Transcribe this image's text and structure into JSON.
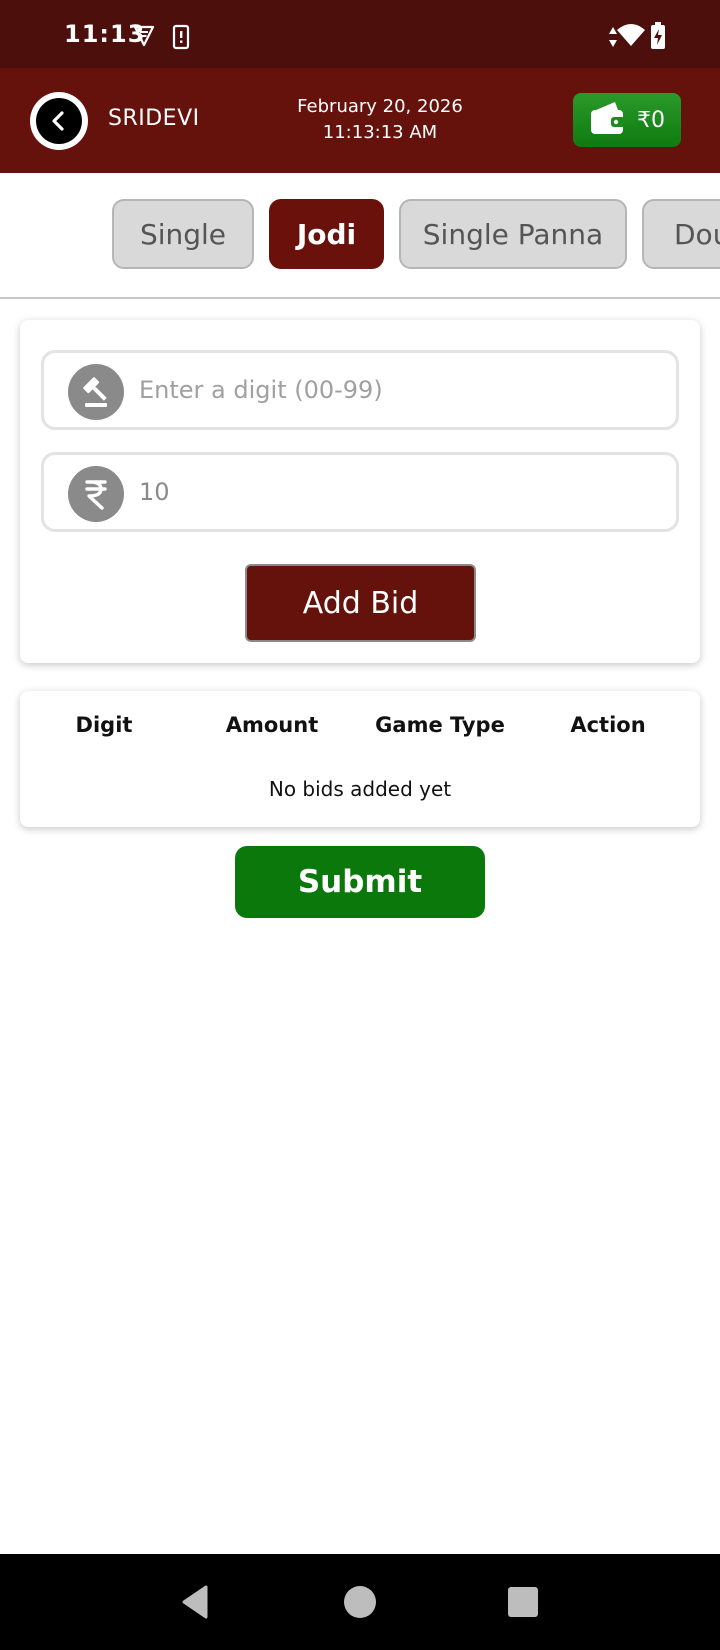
{
  "status_bar": {
    "time": "11:13",
    "icons": [
      "vpn-shield-icon",
      "sim-alert-icon",
      "data-arrows-icon",
      "wifi-icon",
      "battery-charging-icon"
    ]
  },
  "header": {
    "brand": "SRIDEVI",
    "date": "February 20, 2026",
    "time": "11:13:13 AM",
    "wallet_amount": "₹0",
    "back_icon": "chevron-left-icon",
    "wallet_icon": "wallet-icon"
  },
  "tabs": [
    {
      "label": "Single",
      "active": false
    },
    {
      "label": "Jodi",
      "active": true
    },
    {
      "label": "Single Panna",
      "active": false
    },
    {
      "label": "Double Panna",
      "active": false
    }
  ],
  "form": {
    "digit_placeholder": "Enter a digit (00-99)",
    "digit_icon": "gavel-icon",
    "amount_value": "10",
    "amount_icon": "rupee-icon",
    "add_bid_label": "Add Bid"
  },
  "bids_table": {
    "headers": [
      "Digit",
      "Amount",
      "Game Type",
      "Action"
    ],
    "empty_message": "No bids added yet"
  },
  "submit_label": "Submit",
  "colors": {
    "status_bar": "#4c0f0b",
    "header": "#66120c",
    "accent": "#6b110c",
    "wallet_green": "#1a8c1a",
    "submit_green": "#0a780a",
    "tab_inactive": "#d9d9d9"
  },
  "nav_bar": {
    "icons": [
      "nav-back-icon",
      "nav-home-icon",
      "nav-recents-icon"
    ]
  }
}
